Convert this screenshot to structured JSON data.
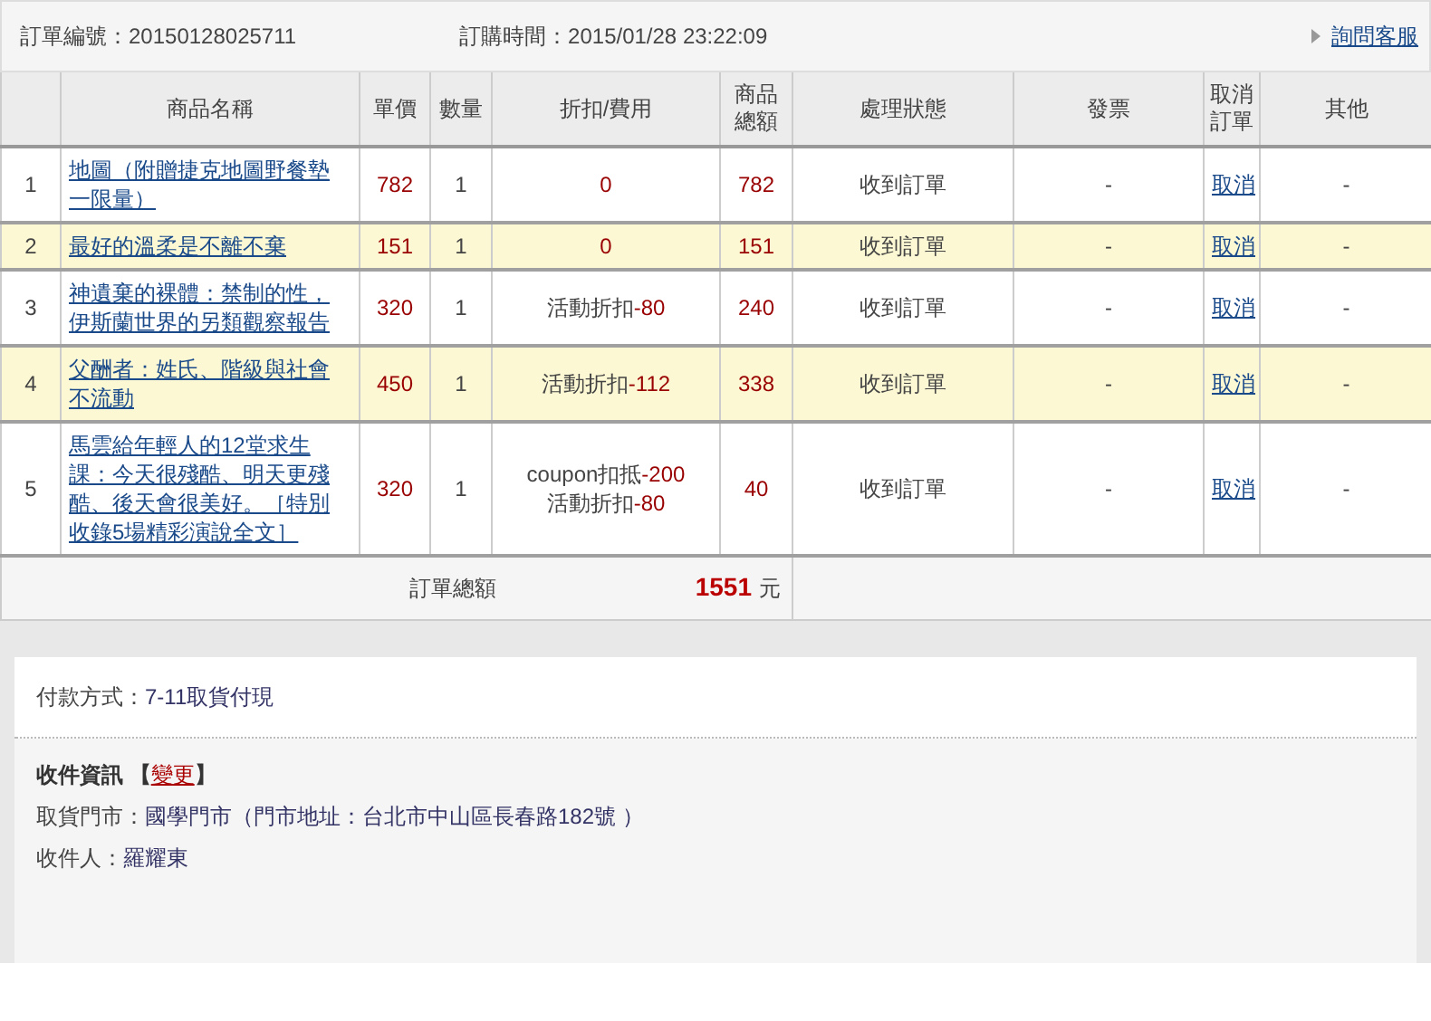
{
  "order": {
    "number_label": "訂單編號：",
    "number": "20150128025711",
    "time_label": "訂購時間：",
    "time": "2015/01/28 23:22:09",
    "service_link": "詢問客服"
  },
  "table": {
    "columns": [
      "商品名稱",
      "單價",
      "數量",
      "折扣/費用",
      "商品總額",
      "處理狀態",
      "發票",
      "取消訂單",
      "其他"
    ],
    "rows": [
      {
        "index": "1",
        "name": "地圖（附贈捷克地圖野餐墊一限量）",
        "price": "782",
        "qty": "1",
        "discounts": [
          {
            "amount": "0"
          }
        ],
        "total": "782",
        "status": "收到訂單",
        "invoice": "-",
        "cancel": "取消",
        "other": "-",
        "highlighted": false
      },
      {
        "index": "2",
        "name": "最好的溫柔是不離不棄",
        "price": "151",
        "qty": "1",
        "discounts": [
          {
            "amount": "0"
          }
        ],
        "total": "151",
        "status": "收到訂單",
        "invoice": "-",
        "cancel": "取消",
        "other": "-",
        "highlighted": true
      },
      {
        "index": "3",
        "name": "神遺棄的裸體：禁制的性，伊斯蘭世界的另類觀察報告",
        "price": "320",
        "qty": "1",
        "discounts": [
          {
            "label": "活動折扣",
            "amount": "-80"
          }
        ],
        "total": "240",
        "status": "收到訂單",
        "invoice": "-",
        "cancel": "取消",
        "other": "-",
        "highlighted": false
      },
      {
        "index": "4",
        "name": "父酬者：姓氏、階級與社會不流動",
        "price": "450",
        "qty": "1",
        "discounts": [
          {
            "label": "活動折扣",
            "amount": "-112"
          }
        ],
        "total": "338",
        "status": "收到訂單",
        "invoice": "-",
        "cancel": "取消",
        "other": "-",
        "highlighted": true
      },
      {
        "index": "5",
        "name": "馬雲給年輕人的12堂求生課：今天很殘酷、明天更殘酷、後天會很美好。［特別收錄5場精彩演說全文］",
        "price": "320",
        "qty": "1",
        "discounts": [
          {
            "label": "coupon扣抵",
            "amount": "-200"
          },
          {
            "label": "活動折扣",
            "amount": "-80"
          }
        ],
        "total": "40",
        "status": "收到訂單",
        "invoice": "-",
        "cancel": "取消",
        "other": "-",
        "highlighted": false
      }
    ],
    "summary": {
      "label": "訂單總額",
      "amount": "1551",
      "unit": "元"
    }
  },
  "payment": {
    "label": "付款方式：",
    "value": "7-11取貨付現"
  },
  "shipping": {
    "title": "收件資訊",
    "bracket_open": "【",
    "change_link": "變更",
    "bracket_close": "】",
    "store_label": "取貨門市：",
    "store": "國學門市（門市地址：台北市中山區長春路182號 ）",
    "recipient_label": "收件人：",
    "recipient": "羅耀東"
  }
}
